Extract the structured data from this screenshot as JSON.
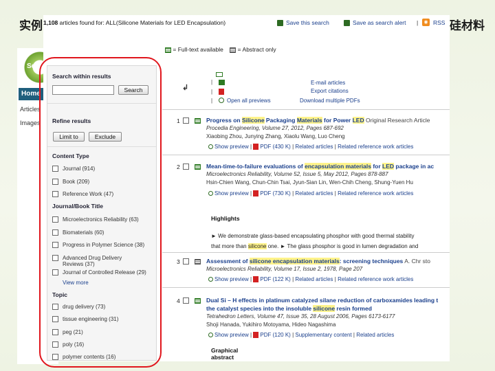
{
  "slide": {
    "title_left": "实例:",
    "title_right": "硅材料"
  },
  "background_page": {
    "logo_text": "Sci",
    "home_tab": "Home",
    "nav_articles": "Articles",
    "nav_images": "Images"
  },
  "toolbar": {
    "found_count": "1,108",
    "found_text": " articles found for: ALL(Silicone Materials for LED Encapsulation)",
    "save_search": "Save this search",
    "save_alert": "Save as search alert",
    "rss": "RSS",
    "rss_icon": "rss-icon"
  },
  "legend": {
    "full_text": "= Full-text available",
    "abstract": "= Abstract only"
  },
  "sidebar": {
    "search_heading": "Search within results",
    "search_value": "",
    "search_button": "Search",
    "refine_heading": "Refine results",
    "limit_button": "Limit to",
    "exclude_button": "Exclude",
    "content_type_heading": "Content Type",
    "content_types": [
      {
        "label": "Journal (914)"
      },
      {
        "label": "Book (209)"
      },
      {
        "label": "Reference Work (47)"
      }
    ],
    "journal_heading": "Journal/Book Title",
    "journals": [
      {
        "label": "Microelectronics Reliability (63)"
      },
      {
        "label": "Biomaterials (60)"
      },
      {
        "label": "Progress in Polymer Science (38)"
      },
      {
        "label": "Advanced Drug Delivery",
        "label2": "Reviews (37)"
      },
      {
        "label": "Journal of Controlled Release (29)"
      }
    ],
    "view_more": "View more",
    "topic_heading": "Topic",
    "topics": [
      {
        "label": "drug delivery (73)"
      },
      {
        "label": "tissue engineering (31)"
      },
      {
        "label": "peg (21)"
      },
      {
        "label": "poly (16)"
      },
      {
        "label": "polymer contents (16)"
      }
    ]
  },
  "actions": {
    "email": "E-mail articles",
    "export": "Export citations",
    "open_previews": "Open all previews",
    "download_pdfs": "Download multiple PDFs"
  },
  "results": [
    {
      "num": "1",
      "title_parts": [
        "Progress on ",
        "Silicone",
        " Packaging ",
        "Materials",
        " for Power ",
        "LED"
      ],
      "type": " Original Research Article",
      "meta": "Procedia Engineering, Volume 27, 2012, Pages 687-692",
      "authors": "Xiaobing Zhou, Junying Zhang, Xiaolu Wang, Luo Cheng",
      "preview": "Show preview",
      "pdf": "PDF (430 K)",
      "related": "Related articles",
      "related_ref": "Related reference work articles"
    },
    {
      "num": "2",
      "title_parts": [
        "Mean-time-to-failure evaluations of ",
        "encapsulation materials",
        " for ",
        "LED",
        " package in ac"
      ],
      "meta": "Microelectronics Reliability, Volume 52, Issue 5, May 2012, Pages 878-887",
      "authors": "Hsin-Chien Wang, Chun-Chin Tsai, Jyun-Sian Lin, Wen-Chih Cheng, Shung-Yuen Hu",
      "preview": "Show preview",
      "pdf": "PDF (730 K)",
      "related": "Related articles",
      "related_ref": "Related reference work articles",
      "highlights_heading": "Highlights",
      "highlight_line1": "► We demonstrate glass-based encapsulating phosphor with good thermal stability",
      "highlight_line2_a": "that more than ",
      "highlight_line2_hl": "silicone",
      "highlight_line2_b": " one. ► The glass phosphor is good in lumen degradation and"
    },
    {
      "num": "3",
      "title_parts": [
        "Assessment of ",
        "silicone encapsulation materials",
        ": screening techniques"
      ],
      "type": " A. Chr sto",
      "meta": "Microelectronics Reliability, Volume 17, Issue 2, 1978, Page 207",
      "preview": "Show preview",
      "pdf": "PDF (122 K)",
      "related": "Related articles",
      "related_ref": "Related reference work articles"
    },
    {
      "num": "4",
      "title_parts": [
        "Dual Si – H effects in platinum catalyzed silane reduction of carboxamides leading t"
      ],
      "title_line2_a": "the catalyst species into the insoluble ",
      "title_line2_hl": "silicone",
      "title_line2_b": " resin formed",
      "meta": "Tetrahedron Letters, Volume 47, Issue 35, 28 August 2006, Pages 6173-6177",
      "authors": "Shoji Hanada, Yukihiro Motoyama, Hideo Nagashima",
      "preview": "Show preview",
      "pdf": "PDF (120 K)",
      "supplementary": "Supplementary content",
      "related": "Related articles",
      "graphical_abstract": "Graphical abstract"
    }
  ],
  "colors": {
    "link": "#1a3f8c",
    "highlight": "#fff38a",
    "oval": "#e0151c",
    "home_tab": "#1f5f7d"
  }
}
